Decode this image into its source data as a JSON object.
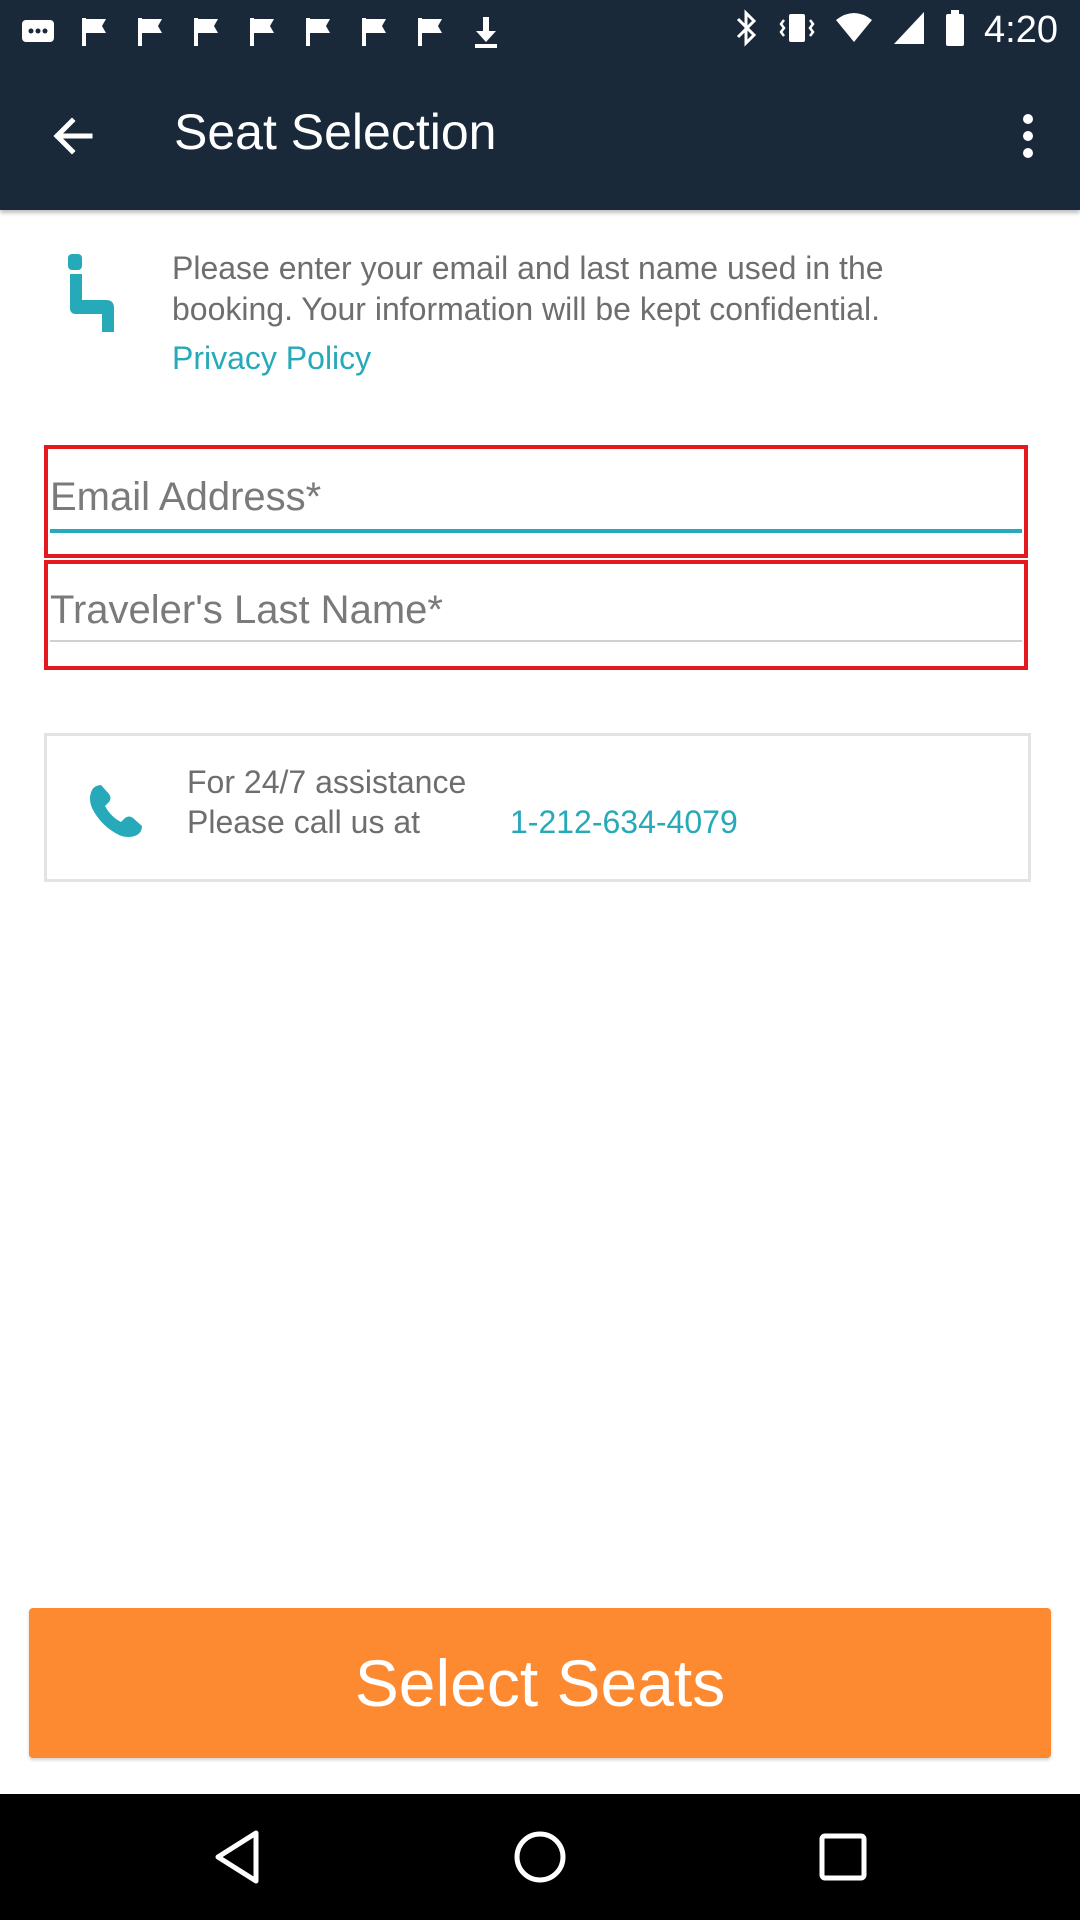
{
  "status_bar": {
    "time": "4:20",
    "notification_icons": [
      "chat-icon",
      "flag-icon",
      "flag-icon",
      "flag-icon",
      "flag-icon",
      "flag-icon",
      "flag-icon",
      "flag-icon",
      "download-icon"
    ],
    "right_icons": [
      "bluetooth-icon",
      "vibrate-icon",
      "wifi-icon",
      "signal-icon",
      "battery-icon"
    ]
  },
  "toolbar": {
    "title": "Seat Selection",
    "back_icon": "arrow-left-icon",
    "more_icon": "more-vert-icon"
  },
  "info": {
    "icon": "seat-icon",
    "text": "Please enter your email and last name used in the booking. Your information will be kept confidential.",
    "privacy_link": "Privacy Policy"
  },
  "form": {
    "email_placeholder": "Email Address*",
    "last_name_placeholder": "Traveler's Last Name*"
  },
  "assistance": {
    "icon": "phone-icon",
    "line1": "For 24/7 assistance",
    "line2": "Please call us at",
    "phone": "1-212-634-4079"
  },
  "actions": {
    "select_seats": "Select Seats"
  },
  "colors": {
    "toolbar_bg": "#19293a",
    "accent_teal": "#26a9b8",
    "cta_orange": "#fd8a31",
    "highlight_red": "#e3191b"
  }
}
